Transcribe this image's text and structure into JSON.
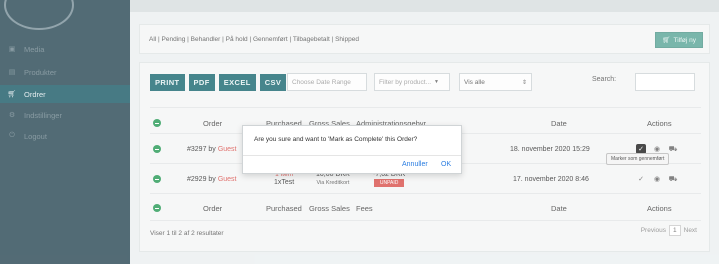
{
  "sidebar": {
    "items": [
      {
        "label": "Media",
        "icon": "image-icon"
      },
      {
        "label": "Produkter",
        "icon": "box-icon"
      },
      {
        "label": "Ordrer",
        "icon": "cart-icon",
        "active": true
      },
      {
        "label": "Indstillinger",
        "icon": "gear-icon"
      },
      {
        "label": "Logout",
        "icon": "logout-icon"
      }
    ]
  },
  "topbar": {
    "filters": "All | Pending | Behandler | På hold | Gennemført | Tilbagebetalt | Shipped",
    "add_label": "Tilføj ny"
  },
  "toolbar": {
    "print": "PRINT",
    "pdf": "PDF",
    "excel": "EXCEL",
    "csv": "CSV",
    "date_range": "Choose Date Range",
    "product_filter": "Filter by product...",
    "show": "Vis alle",
    "search_label": "Search:"
  },
  "table": {
    "headers": [
      "Order",
      "Purchased",
      "Gross Sales",
      "Administrationsgebyr",
      "Date",
      "Actions"
    ],
    "footer_headers": [
      "Order",
      "Purchased",
      "Gross Sales",
      "Fees",
      "Date",
      "Actions"
    ],
    "rows": [
      {
        "order": "#3297 by",
        "guest": "Guest",
        "date": "18. november 2020 15:29"
      },
      {
        "order": "#2929 by",
        "guest": "Guest",
        "purchased_top": "1 Item",
        "purchased": "1xTest",
        "gross_top": "10,00 DKK",
        "gross_sub": "Via Kreditkort",
        "fee_top": "-7,62 DKK",
        "fee_badge": "UNPAID",
        "date": "17. november 2020 8:46"
      }
    ]
  },
  "tooltip": "Marker som gennemført",
  "footer": {
    "summary": "Viser 1 til 2 af 2 resultater",
    "previous": "Previous",
    "page": "1",
    "next": "Next"
  },
  "modal": {
    "message": "Are you sure and want to 'Mark as Complete' this Order?",
    "cancel": "Annuller",
    "ok": "OK"
  }
}
